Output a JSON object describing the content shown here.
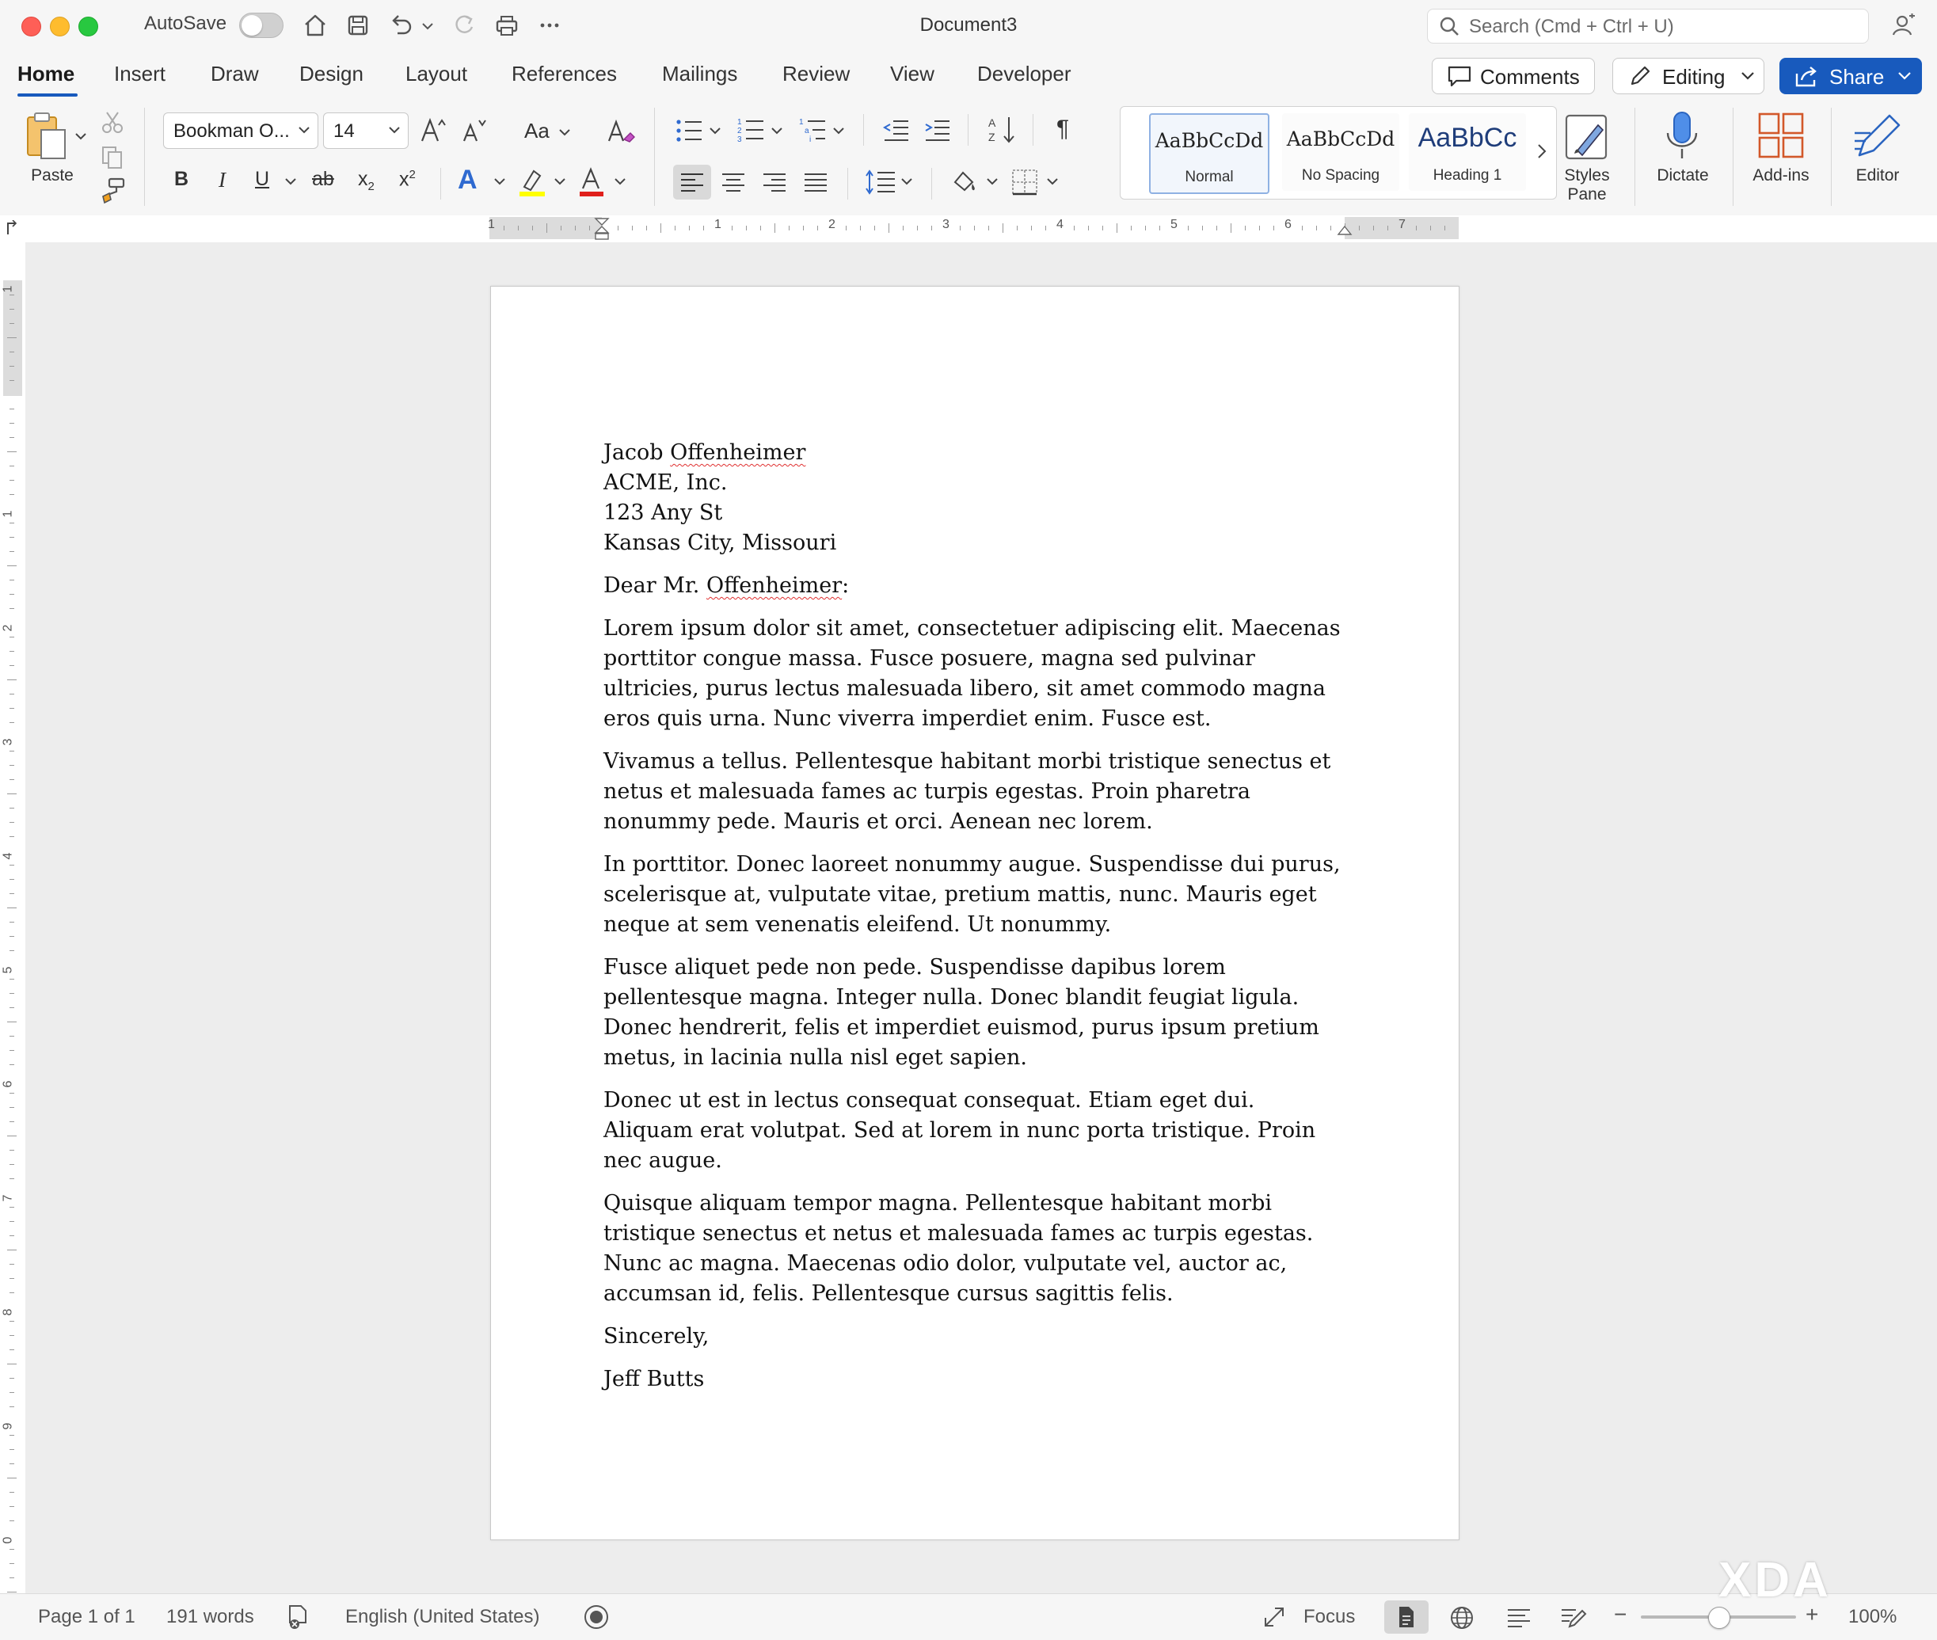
{
  "titlebar": {
    "autosave_label": "AutoSave",
    "autosave_on": false,
    "document_title": "Document3",
    "search_placeholder": "Search (Cmd + Ctrl + U)"
  },
  "tabs": [
    {
      "label": "Home",
      "active": true
    },
    {
      "label": "Insert"
    },
    {
      "label": "Draw"
    },
    {
      "label": "Design"
    },
    {
      "label": "Layout"
    },
    {
      "label": "References"
    },
    {
      "label": "Mailings"
    },
    {
      "label": "Review"
    },
    {
      "label": "View"
    },
    {
      "label": "Developer"
    }
  ],
  "actions": {
    "comments_label": "Comments",
    "editing_label": "Editing",
    "share_label": "Share"
  },
  "ribbon": {
    "paste_label": "Paste",
    "font_name": "Bookman O...",
    "font_size": "14",
    "change_case_label": "Aa",
    "styles": [
      {
        "sample": "AaBbCcDd",
        "name": "Normal",
        "selected": true
      },
      {
        "sample": "AaBbCcDd",
        "name": "No Spacing"
      },
      {
        "sample": "AaBbCc",
        "name": "Heading 1"
      }
    ],
    "styles_pane_label_1": "Styles",
    "styles_pane_label_2": "Pane",
    "dictate_label": "Dictate",
    "addins_label": "Add-ins",
    "editor_label": "Editor"
  },
  "ruler": {
    "h_numbers": [
      "1",
      "1",
      "2",
      "3",
      "4",
      "5",
      "6",
      "7"
    ],
    "v_numbers": [
      "1",
      "1",
      "2",
      "3",
      "4",
      "5",
      "6",
      "7",
      "8",
      "9",
      "0"
    ]
  },
  "document": {
    "address": [
      "Jacob Offenheimer",
      "ACME, Inc.",
      "123 Any St",
      "Kansas City, Missouri"
    ],
    "address_first_plain": "Jacob ",
    "address_first_squiggle": "Offenheimer",
    "salutation_plain": "Dear Mr. ",
    "salutation_squiggle": "Offenheimer",
    "salutation_end": ":",
    "paragraphs": [
      "Lorem ipsum dolor sit amet, consectetuer adipiscing elit. Maecenas porttitor congue massa. Fusce posuere, magna sed pulvinar ultricies, purus lectus malesuada libero, sit amet commodo magna eros quis urna. Nunc viverra imperdiet enim. Fusce est.",
      "Vivamus a tellus. Pellentesque habitant morbi tristique senectus et netus et malesuada fames ac turpis egestas. Proin pharetra nonummy pede. Mauris et orci. Aenean nec lorem.",
      "In porttitor. Donec laoreet nonummy augue. Suspendisse dui purus, scelerisque at, vulputate vitae, pretium mattis, nunc. Mauris eget neque at sem venenatis eleifend. Ut nonummy.",
      "Fusce aliquet pede non pede. Suspendisse dapibus lorem pellentesque magna. Integer nulla. Donec blandit feugiat ligula. Donec hendrerit, felis et imperdiet euismod, purus ipsum pretium metus, in lacinia nulla nisl eget sapien.",
      "Donec ut est in lectus consequat consequat. Etiam eget dui. Aliquam erat volutpat. Sed at lorem in nunc porta tristique. Proin nec augue.",
      "Quisque aliquam tempor magna. Pellentesque habitant morbi tristique senectus et netus et malesuada fames ac turpis egestas. Nunc ac magna. Maecenas odio dolor, vulputate vel, auctor ac, accumsan id, felis. Pellentesque cursus sagittis felis."
    ],
    "closing": "Sincerely,",
    "signature": "Jeff Butts"
  },
  "statusbar": {
    "page_info": "Page 1 of 1",
    "word_count": "191 words",
    "language": "English (United States)",
    "focus_label": "Focus",
    "zoom_level": "100%",
    "zoom_fraction": 0.5
  },
  "watermark": "XDA",
  "colors": {
    "accent": "#185abd",
    "font_color_bar": "#e0201c",
    "highlight_bar": "#ffff00"
  }
}
